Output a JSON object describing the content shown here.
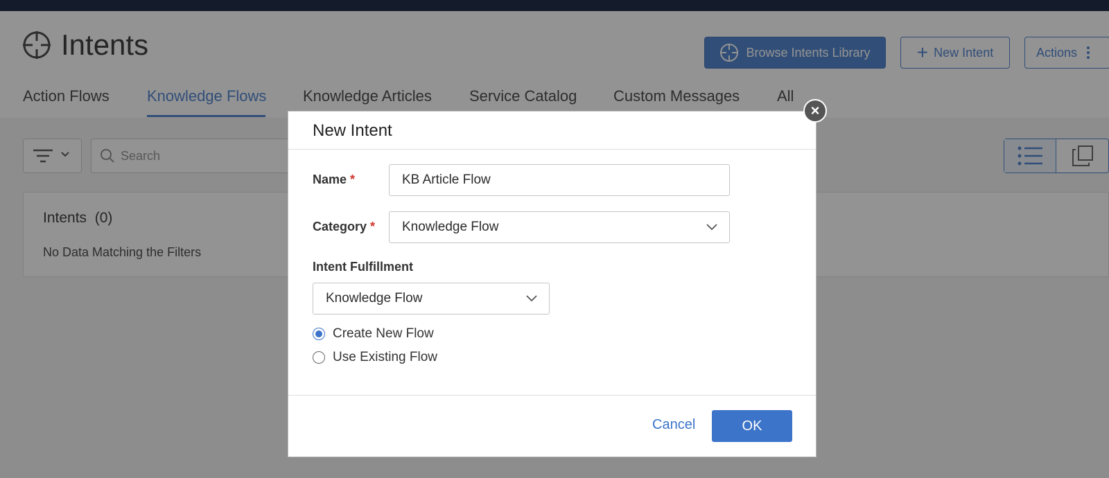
{
  "page": {
    "title": "Intents",
    "buttons": {
      "browse_library": "Browse Intents Library",
      "new_intent": "New Intent",
      "actions": "Actions"
    },
    "tabs": [
      {
        "label": "Action Flows",
        "active": false
      },
      {
        "label": "Knowledge Flows",
        "active": true
      },
      {
        "label": "Knowledge Articles",
        "active": false
      },
      {
        "label": "Service Catalog",
        "active": false
      },
      {
        "label": "Custom Messages",
        "active": false
      },
      {
        "label": "All",
        "active": false
      }
    ],
    "search": {
      "placeholder": "Search"
    },
    "panel": {
      "title": "Intents",
      "count": "(0)",
      "empty_message": "No Data Matching the Filters"
    }
  },
  "modal": {
    "title": "New Intent",
    "close_symbol": "×",
    "name": {
      "label": "Name",
      "required_mark": "*",
      "value": "KB Article Flow"
    },
    "category": {
      "label": "Category",
      "required_mark": "*",
      "value": "Knowledge Flow"
    },
    "fulfillment": {
      "label": "Intent Fulfillment",
      "value": "Knowledge Flow",
      "options": [
        {
          "label": "Create New Flow",
          "checked": true
        },
        {
          "label": "Use Existing Flow",
          "checked": false
        }
      ]
    },
    "cancel_label": "Cancel",
    "ok_label": "OK"
  },
  "theme": {
    "accent": "#3b74c9",
    "topbar": "#141b2b",
    "required": "#d0342c"
  },
  "icons": [
    "crosshair-icon",
    "plus-icon",
    "kebab-icon",
    "filter-icon",
    "chevron-down-icon",
    "search-icon",
    "list-view-icon",
    "card-view-icon",
    "close-icon"
  ]
}
